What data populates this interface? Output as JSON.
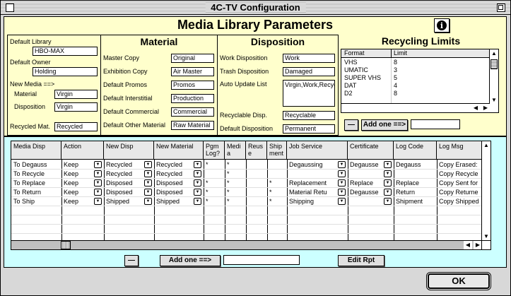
{
  "window": {
    "title": "4C-TV Configuration"
  },
  "params": {
    "title": "Media Library Parameters",
    "general": {
      "default_library_label": "Default Library",
      "default_library_value": "HBO-MAX",
      "default_owner_label": "Default Owner",
      "default_owner_value": "Holding",
      "new_media_label": "New Media ==>",
      "material_label": "Material",
      "material_value": "Virgin",
      "disposition_label": "Disposition",
      "disposition_value": "Virgin",
      "recycled_mat_label": "Recycled Mat.",
      "recycled_mat_value": "Recycled"
    },
    "material": {
      "title": "Material",
      "rows": [
        {
          "label": "Master Copy",
          "value": "Original"
        },
        {
          "label": "Exhibition Copy",
          "value": "Air Master"
        },
        {
          "label": "Default Promos",
          "value": "Promos"
        },
        {
          "label": "Default Interstitial",
          "value": "Production"
        },
        {
          "label": "Default Commercial",
          "value": "Commercial"
        },
        {
          "label": "Default Other Material",
          "value": "Raw Material"
        }
      ]
    },
    "disposition": {
      "title": "Disposition",
      "work_label": "Work Disposition",
      "work_value": "Work",
      "trash_label": "Trash Disposition",
      "trash_value": "Damaged",
      "auto_update_label": "Auto Update List",
      "auto_update_value": "Virgin,Work,Recycled",
      "recyclable_label": "Recyclable Disp.",
      "recyclable_value": "Recyclable",
      "default_label": "Default Disposition",
      "default_value": "Permanent"
    },
    "recycling": {
      "title": "Recycling Limits",
      "col_format": "Format",
      "col_limit": "Limit",
      "rows": [
        {
          "format": "VHS",
          "limit": "8"
        },
        {
          "format": "UMATIC",
          "limit": "3"
        },
        {
          "format": "SUPER VHS",
          "limit": "5"
        },
        {
          "format": "DAT",
          "limit": "4"
        },
        {
          "format": "D2",
          "limit": "8"
        }
      ],
      "minus_label": "—",
      "add_label": "Add one ==>",
      "add_value": ""
    }
  },
  "table": {
    "headers": [
      "Media Disp",
      "Action",
      "New Disp",
      "New Material",
      "Pgm Log?",
      "Medi a",
      "Reus e",
      "Ship ment",
      "Job Service",
      "Certificate",
      "Log Code",
      "Log Msg"
    ],
    "rows": [
      [
        "To Degauss",
        "Keep",
        "Recycled",
        "Recycled",
        "*",
        "*",
        "",
        "",
        "Degaussing",
        "Degausse",
        "Degauss",
        "Copy Erased:"
      ],
      [
        "To Recycle",
        "Keep",
        "Recycled",
        "Recycled",
        "",
        "*",
        "",
        "",
        "",
        "",
        "",
        "Copy Recycle"
      ],
      [
        "To Replace",
        "Keep",
        "Disposed",
        "Disposed",
        "*",
        "*",
        "",
        "*",
        "Replacement",
        "Replace",
        "Replace",
        "Copy Sent for"
      ],
      [
        "To Return",
        "Keep",
        "Disposed",
        "Disposed",
        "*",
        "*",
        "",
        "*",
        "Material Retu",
        "Degausse",
        "Return",
        "Copy Returne"
      ],
      [
        "To Ship",
        "Keep",
        "Shipped",
        "Shipped",
        "*",
        "*",
        "",
        "*",
        "Shipping",
        "",
        "Shipment",
        "Copy Shipped"
      ]
    ],
    "minus_label": "—",
    "add_label": "Add one ==>",
    "add_value": "",
    "edit_label": "Edit Rpt"
  },
  "ok_label": "OK"
}
